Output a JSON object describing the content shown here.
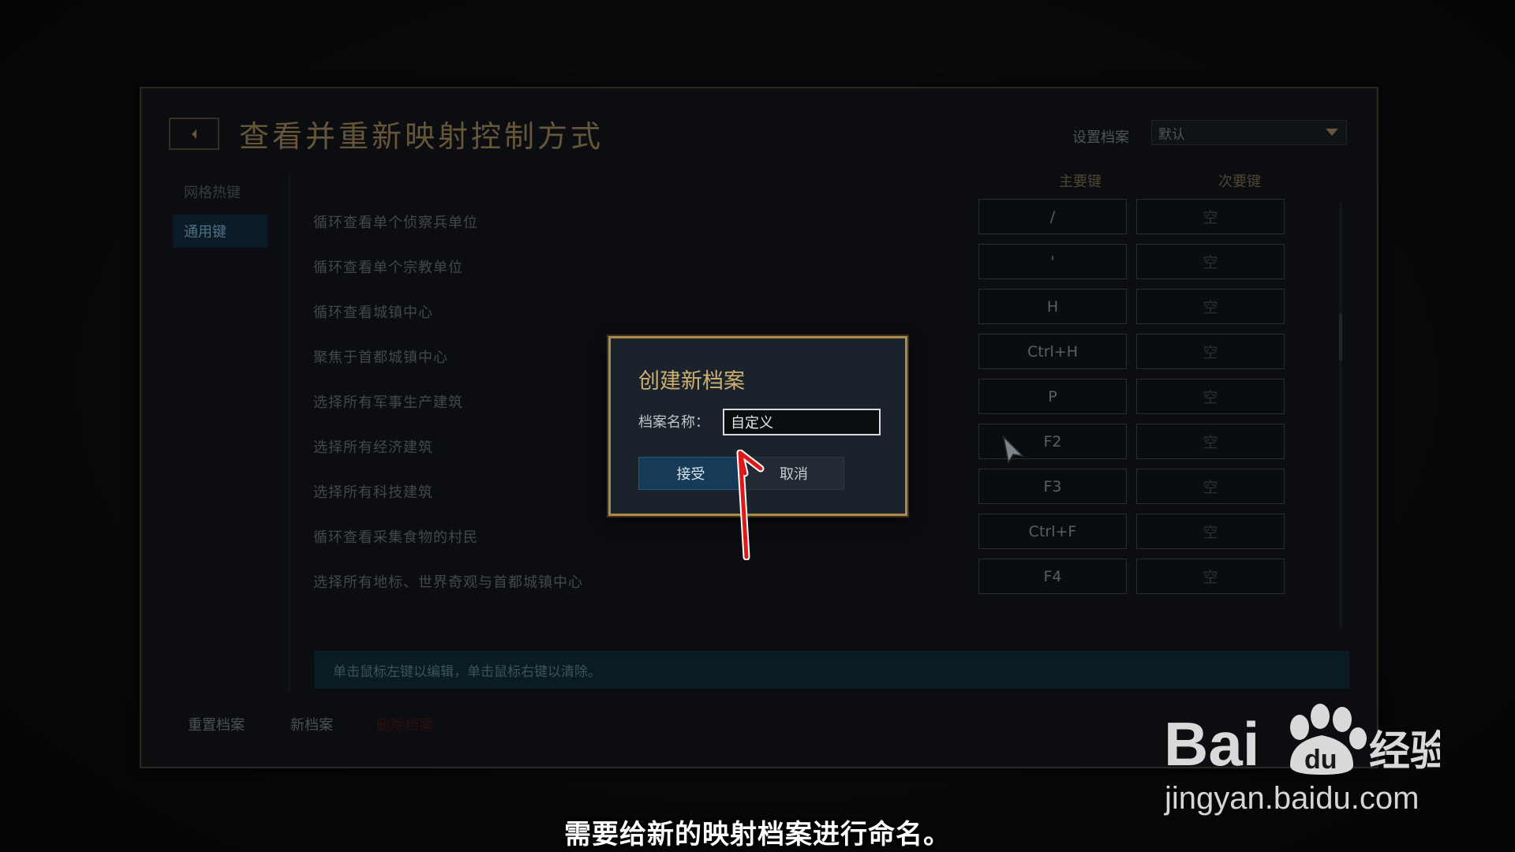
{
  "window": {
    "title": "查看并重新映射控制方式",
    "profile_label": "设置档案",
    "profile_selected": "默认"
  },
  "sidebar": {
    "items": [
      {
        "label": "网格热键",
        "active": false
      },
      {
        "label": "通用键",
        "active": true
      }
    ]
  },
  "table": {
    "headers": {
      "primary": "主要键",
      "secondary": "次要键"
    },
    "rows": [
      {
        "label": "循环查看单个侦察兵单位",
        "primary": "/",
        "secondary": "空"
      },
      {
        "label": "循环查看单个宗教单位",
        "primary": "'",
        "secondary": "空"
      },
      {
        "label": "循环查看城镇中心",
        "primary": "H",
        "secondary": "空"
      },
      {
        "label": "聚焦于首都城镇中心",
        "primary": "Ctrl+H",
        "secondary": "空"
      },
      {
        "label": "选择所有军事生产建筑",
        "primary": "P",
        "secondary": "空"
      },
      {
        "label": "选择所有经济建筑",
        "primary": "F2",
        "secondary": "空"
      },
      {
        "label": "选择所有科技建筑",
        "primary": "F3",
        "secondary": "空"
      },
      {
        "label": "循环查看采集食物的村民",
        "primary": "Ctrl+F",
        "secondary": "空"
      },
      {
        "label": "选择所有地标、世界奇观与首都城镇中心",
        "primary": "F4",
        "secondary": "空"
      }
    ]
  },
  "hint": "单击鼠标左键以编辑，单击鼠标右键以清除。",
  "footer": {
    "reset": "重置档案",
    "new": "新档案",
    "delete": "删除档案"
  },
  "modal": {
    "title": "创建新档案",
    "name_label": "档案名称：",
    "name_value": "自定义",
    "accept": "接受",
    "cancel": "取消"
  },
  "overlay": {
    "watermark_brand": "Bai du 经验",
    "watermark_url": "jingyan.baidu.com",
    "subtitle": "需要给新的映射档案进行命名。"
  },
  "colors": {
    "accent_gold": "#a98a4c",
    "accept_blue": "#173a58",
    "hint_bar": "#0d2631",
    "arrow_red": "#e01818"
  }
}
